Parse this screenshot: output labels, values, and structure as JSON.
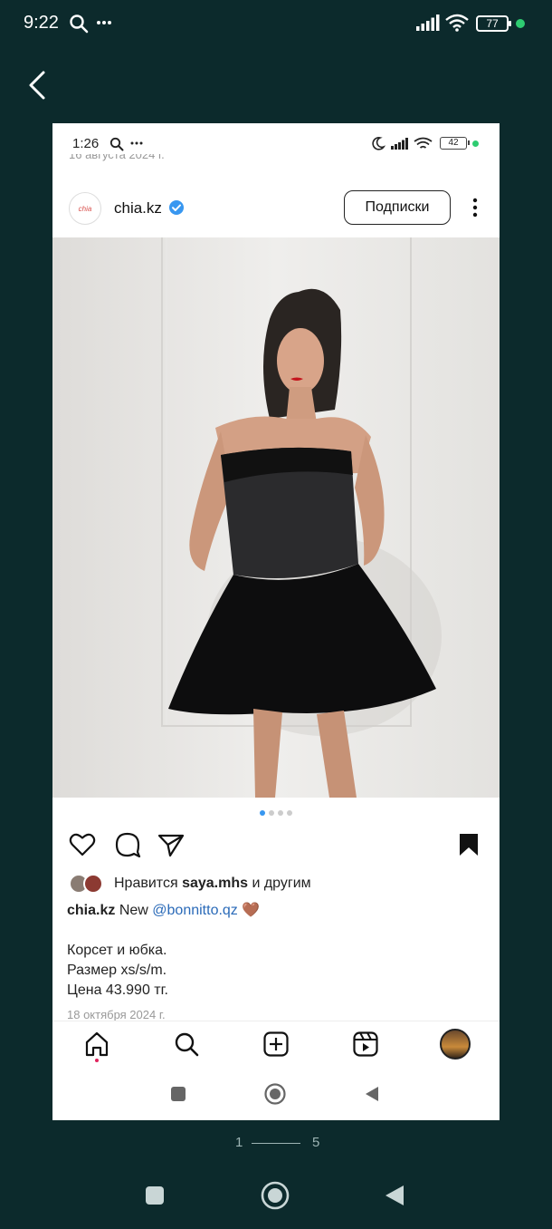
{
  "status_bar": {
    "time": "9:22",
    "battery": "77"
  },
  "inner": {
    "status_bar": {
      "time": "1:26",
      "battery": "42"
    },
    "cut_date": "16 августа 2024 г.",
    "post": {
      "username": "chia.kz",
      "avatar_text": "chia",
      "subscribe_label": "Подписки",
      "likes": {
        "prefix": "Нравится",
        "user": "saya.mhs",
        "suffix": "и другим"
      },
      "caption": {
        "user": "chia.kz",
        "word": "New",
        "mention": "@bonnitto.qz",
        "emoji": "🤎",
        "lines": [
          "Корсет и юбка.",
          "Размер xs/s/m.",
          "Цена 43.990 тг."
        ]
      },
      "date": "18 октября 2024 г.",
      "carousel": {
        "count": 4,
        "active": 1
      }
    }
  },
  "pager": {
    "current": "1",
    "total": "5"
  },
  "colors": {
    "bg": "#0c2a2c",
    "link": "#2a6ab8",
    "accent": "#3897f0"
  }
}
